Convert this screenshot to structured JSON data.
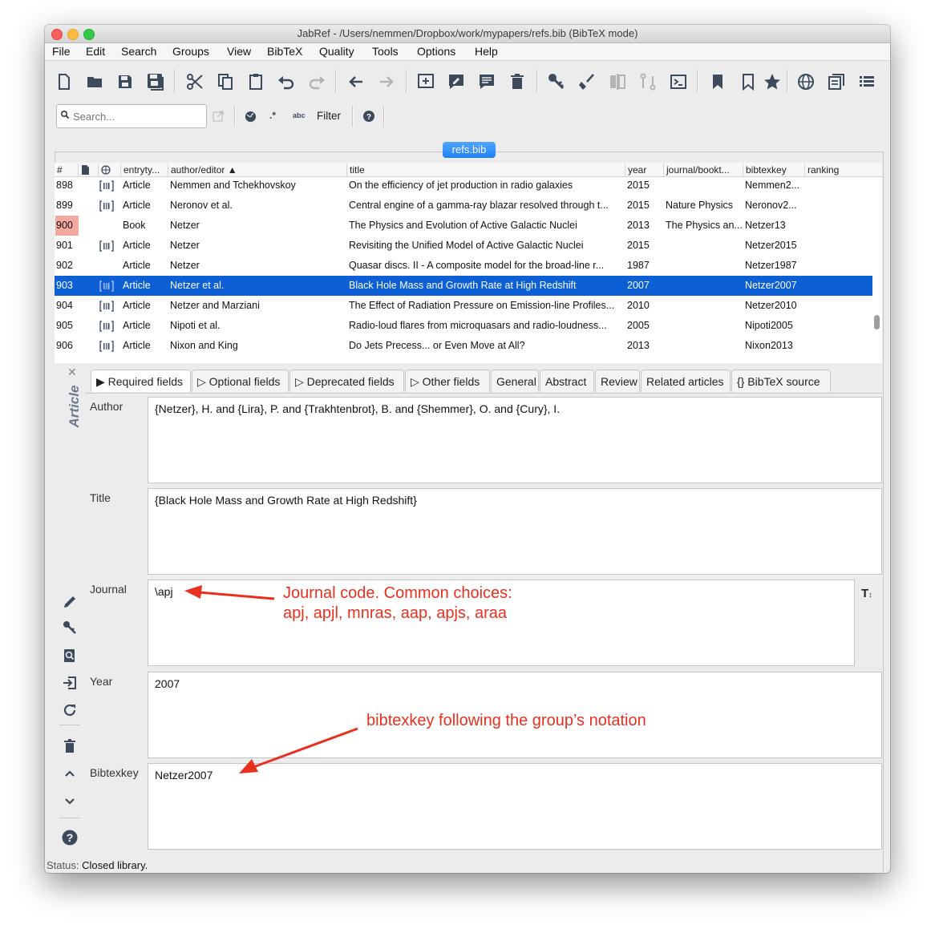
{
  "window": {
    "title": "JabRef - /Users/nemmen/Dropbox/work/mypapers/refs.bib (BibTeX mode)"
  },
  "menu": [
    "File",
    "Edit",
    "Search",
    "Groups",
    "View",
    "BibTeX",
    "Quality",
    "Tools",
    "Options",
    "Help"
  ],
  "search": {
    "placeholder": "Search...",
    "filter_label": "Filter",
    "regex_label": ".*",
    "case_label": "abc"
  },
  "library_tab": "refs.bib",
  "table": {
    "columns": [
      "#",
      "",
      "",
      "entryty...",
      "author/editor",
      "title",
      "year",
      "journal/bookt...",
      "bibtexkey",
      "ranking"
    ],
    "rows": [
      {
        "num": "898",
        "type": "Article",
        "author": "Nemmen and Tchekhovskoy",
        "title": "On the efficiency of jet production in radio galaxies",
        "year": "2015",
        "journal": "",
        "key": "Nemmen2...",
        "link": true
      },
      {
        "num": "899",
        "type": "Article",
        "author": "Neronov et al.",
        "title": "Central engine of a gamma-ray blazar resolved through t...",
        "year": "2015",
        "journal": "Nature Physics",
        "key": "Neronov2...",
        "link": true
      },
      {
        "num": "900",
        "type": "Book",
        "author": "Netzer",
        "title": "The Physics and Evolution of Active Galactic Nuclei",
        "year": "2013",
        "journal": "The Physics an...",
        "key": "Netzer13",
        "link": false,
        "flag": true
      },
      {
        "num": "901",
        "type": "Article",
        "author": "Netzer",
        "title": "Revisiting the Unified Model of Active Galactic Nuclei",
        "year": "2015",
        "journal": "",
        "key": "Netzer2015",
        "link": true
      },
      {
        "num": "902",
        "type": "Article",
        "author": "Netzer",
        "title": "Quasar discs. II - A composite model for the broad-line r...",
        "year": "1987",
        "journal": "",
        "key": "Netzer1987",
        "link": false
      },
      {
        "num": "903",
        "type": "Article",
        "author": "Netzer et al.",
        "title": "Black Hole Mass and Growth Rate at High Redshift",
        "year": "2007",
        "journal": "",
        "key": "Netzer2007",
        "link": true,
        "selected": true
      },
      {
        "num": "904",
        "type": "Article",
        "author": "Netzer and Marziani",
        "title": "The Effect of Radiation Pressure on Emission-line Profiles...",
        "year": "2010",
        "journal": "",
        "key": "Netzer2010",
        "link": true
      },
      {
        "num": "905",
        "type": "Article",
        "author": "Nipoti et al.",
        "title": "Radio-loud flares from microquasars and radio-loudness...",
        "year": "2005",
        "journal": "",
        "key": "Nipoti2005",
        "link": true
      },
      {
        "num": "906",
        "type": "Article",
        "author": "Nixon and King",
        "title": "Do Jets Precess... or Even Move at All?",
        "year": "2013",
        "journal": "",
        "key": "Nixon2013",
        "link": true
      }
    ]
  },
  "editor": {
    "entry_type": "Article",
    "tabs": [
      "Required fields",
      "Optional fields",
      "Deprecated fields",
      "Other fields",
      "General",
      "Abstract",
      "Review",
      "Related articles",
      "BibTeX source"
    ],
    "fields": [
      {
        "label": "Author",
        "value": "{Netzer}, H. and {Lira}, P. and {Trakhtenbrot}, B. and {Shemmer}, O. and {Cury}, I."
      },
      {
        "label": "Title",
        "value": "{Black Hole Mass and Growth Rate at High Redshift}"
      },
      {
        "label": "Journal",
        "value": "\\apj"
      },
      {
        "label": "Year",
        "value": "2007"
      },
      {
        "label": "Bibtexkey",
        "value": "Netzer2007"
      }
    ]
  },
  "annotations": {
    "journal_line1": "Journal code. Common choices:",
    "journal_line2": "apj, apjl, mnras, aap, apjs, araa",
    "bibtexkey": "bibtexkey following the group’s notation"
  },
  "status": {
    "label": "Status:",
    "text": "Closed library."
  },
  "colors": {
    "selection": "#0c5fd4",
    "accent": "#1f7ff3",
    "annotation": "#e8301e",
    "flag": "#f4a9a0"
  }
}
